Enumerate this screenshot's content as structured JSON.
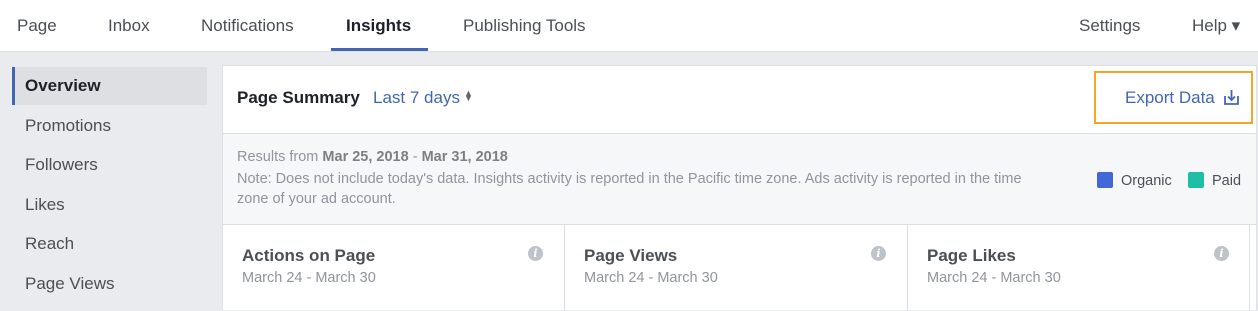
{
  "topnav": {
    "tabs": [
      {
        "label": "Page"
      },
      {
        "label": "Inbox"
      },
      {
        "label": "Notifications"
      },
      {
        "label": "Insights"
      },
      {
        "label": "Publishing Tools"
      }
    ],
    "active_tab": "Insights",
    "settings": "Settings",
    "help": "Help ▾"
  },
  "sidebar": {
    "items": [
      {
        "label": "Overview"
      },
      {
        "label": "Promotions"
      },
      {
        "label": "Followers"
      },
      {
        "label": "Likes"
      },
      {
        "label": "Reach"
      },
      {
        "label": "Page Views"
      }
    ],
    "active": "Overview"
  },
  "summary": {
    "title": "Page Summary",
    "range": "Last 7 days",
    "sort_icon": "sort-arrows-icon",
    "export_label": "Export Data",
    "export_icon": "download-icon"
  },
  "results": {
    "prefix": "Results from ",
    "start": "Mar 25, 2018",
    "sep": " - ",
    "end": "Mar 31, 2018",
    "note": "Note: Does not include today's data. Insights activity is reported in the Pacific time zone. Ads activity is reported in the time zone of your ad account."
  },
  "legend": {
    "organic": {
      "label": "Organic",
      "color": "#4267d6"
    },
    "paid": {
      "label": "Paid",
      "color": "#1fbfa5"
    }
  },
  "cards": [
    {
      "title": "Actions on Page",
      "date": "March 24 - March 30",
      "info": "i"
    },
    {
      "title": "Page Views",
      "date": "March 24 - March 30",
      "info": "i"
    },
    {
      "title": "Page Likes",
      "date": "March 24 - March 30",
      "info": "i"
    }
  ],
  "colors": {
    "accent": "#4267b2",
    "highlight_border": "#f5a623"
  }
}
